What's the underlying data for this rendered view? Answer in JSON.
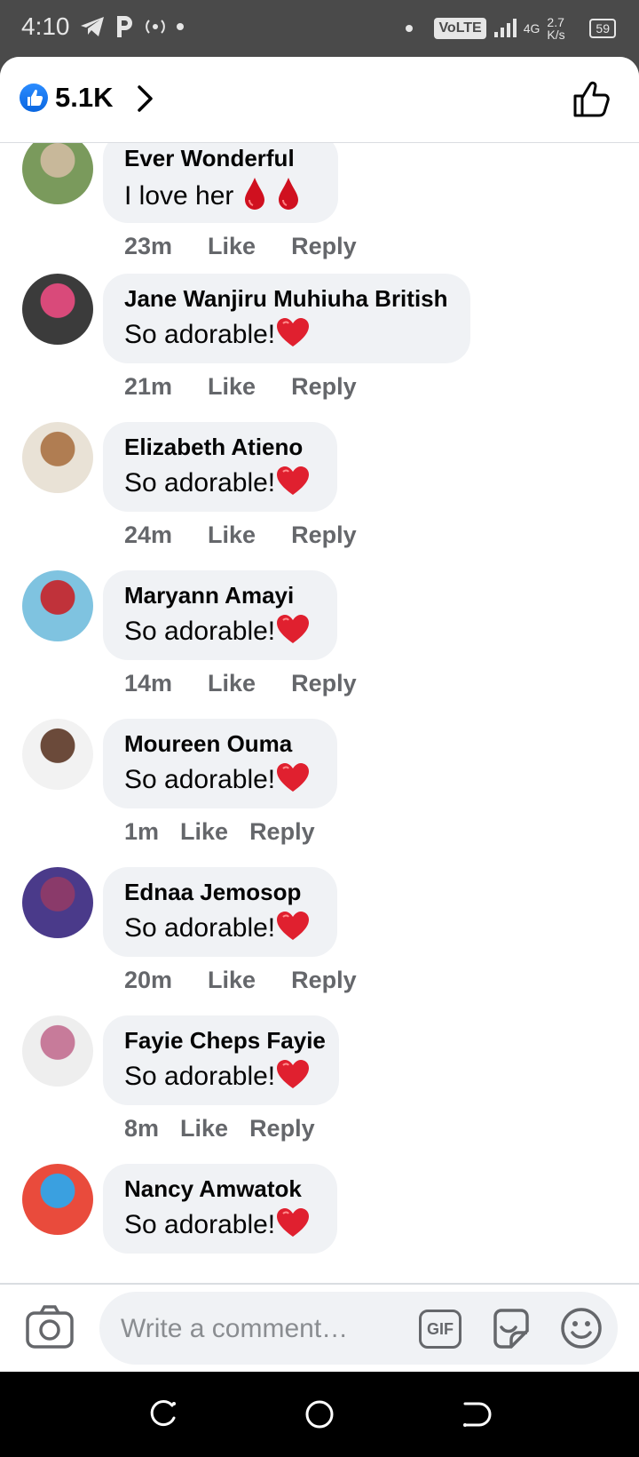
{
  "status_bar": {
    "time": "4:10",
    "network_badge": "VoLTE",
    "signal_label": "4G",
    "speed": "2.7 K/s",
    "battery": "59"
  },
  "header": {
    "like_count": "5.1K"
  },
  "comments": [
    {
      "name": "Ever Wonderful",
      "text": "I love her",
      "emoji": "drops",
      "time": "23m",
      "like": "Like",
      "reply": "Reply",
      "avatar_colors": [
        "#7a9a5c",
        "#c8b89a"
      ]
    },
    {
      "name": "Jane Wanjiru Muhiuha British",
      "text": "So adorable!",
      "emoji": "heart",
      "time": "21m",
      "like": "Like",
      "reply": "Reply",
      "avatar_colors": [
        "#3b3b3b",
        "#d94a7a"
      ]
    },
    {
      "name": "Elizabeth Atieno",
      "text": "So adorable!",
      "emoji": "heart",
      "time": "24m",
      "like": "Like",
      "reply": "Reply",
      "avatar_colors": [
        "#e9e2d6",
        "#b07d52"
      ]
    },
    {
      "name": "Maryann Amayi",
      "text": "So adorable!",
      "emoji": "heart",
      "time": "14m",
      "like": "Like",
      "reply": "Reply",
      "avatar_colors": [
        "#7fc3e0",
        "#c0323a"
      ]
    },
    {
      "name": "Moureen Ouma",
      "text": "So adorable!",
      "emoji": "heart",
      "time": "1m",
      "like": "Like",
      "reply": "Reply",
      "avatar_colors": [
        "#f2f2f2",
        "#6b4a3a"
      ]
    },
    {
      "name": "Ednaa Jemosop",
      "text": "So adorable!",
      "emoji": "heart",
      "time": "20m",
      "like": "Like",
      "reply": "Reply",
      "avatar_colors": [
        "#4a3a8a",
        "#8a3a6a"
      ]
    },
    {
      "name": "Fayie Cheps Fayie",
      "text": "So adorable!",
      "emoji": "heart",
      "time": "8m",
      "like": "Like",
      "reply": "Reply",
      "avatar_colors": [
        "#eeeeee",
        "#c77b9a"
      ]
    },
    {
      "name": "Nancy Amwatok",
      "text": "So adorable!",
      "emoji": "heart",
      "time": "",
      "like": "",
      "reply": "",
      "avatar_colors": [
        "#e94b3c",
        "#3aa0e0"
      ]
    }
  ],
  "composer": {
    "placeholder": "Write a comment…",
    "gif_label": "GIF"
  },
  "colors": {
    "facebook_blue": "#1877f2",
    "bubble_gray": "#f0f2f5",
    "meta_gray": "#65676b",
    "heart_red": "#e0202f"
  }
}
